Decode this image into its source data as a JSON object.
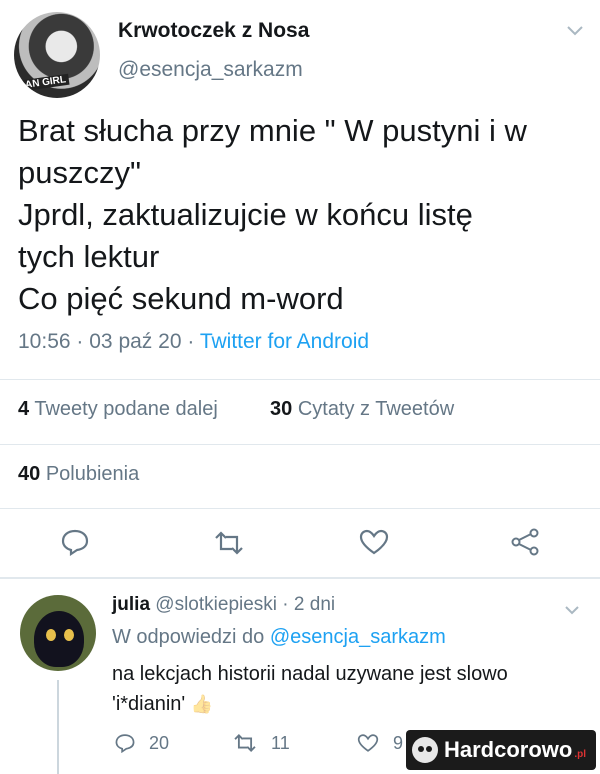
{
  "tweet": {
    "author": {
      "display_name": "Krwotoczek z Nosa",
      "handle": "@esencja_sarkazm",
      "avatar_caption": "AN GIRL"
    },
    "text_lines": [
      "Brat słucha przy mnie \" W pustyni i w",
      "puszczy\"",
      "Jprdl, zaktualizujcie w końcu listę",
      "tych lektur",
      "Co pięć sekund m-word"
    ],
    "time": "10:56",
    "date": "03 paź 20",
    "separator": "·",
    "source": "Twitter for Android",
    "stats": {
      "retweets_count": "4",
      "retweets_label": "Tweety podane dalej",
      "quotes_count": "30",
      "quotes_label": "Cytaty z Tweetów",
      "likes_count": "40",
      "likes_label": "Polubienia"
    },
    "actions": {
      "reply_icon": "reply-icon",
      "retweet_icon": "retweet-icon",
      "like_icon": "heart-icon",
      "share_icon": "share-icon"
    }
  },
  "reply": {
    "name": "julia",
    "handle": "@slotkiepieski",
    "separator": "·",
    "time": "2 dni",
    "in_reply_to_prefix": "W odpowiedzi do",
    "in_reply_to_handle": "@esencja_sarkazm",
    "text_line1": "na lekcjach historii nadal uzywane jest slowo",
    "text_line2": "'i*dianin'",
    "emoji": "👍",
    "reply_count": "20",
    "retweet_count": "11",
    "like_count": "9"
  },
  "watermark": {
    "text": "Hardcorowo",
    "suffix": ".pl"
  },
  "colors": {
    "link": "#1da1f2",
    "secondary_text": "#657786",
    "primary_text": "#14171a",
    "divider": "#e1e8ed"
  }
}
